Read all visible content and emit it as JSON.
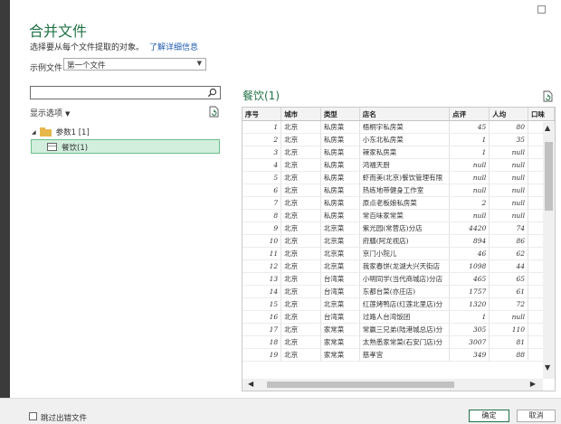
{
  "dialog": {
    "title": "合并文件",
    "subtitle": "选择要从每个文件提取的对象。",
    "learn_more": "了解详细信息",
    "sample_file_label": "示例文件:",
    "sample_file_value": "第一个文件"
  },
  "navigator": {
    "search_placeholder": "",
    "display_options": "显示选项",
    "folder_label": "参数1 [1]",
    "sheet_label": "餐饮(1)"
  },
  "preview": {
    "title": "餐饮(1)",
    "columns": [
      "序号",
      "城市",
      "类型",
      "店名",
      "点评",
      "人均",
      "口味"
    ],
    "rows": [
      [
        "1",
        "北京",
        "私房菜",
        "梧桐宇私房菜",
        "45",
        "80",
        ""
      ],
      [
        "2",
        "北京",
        "私房菜",
        "小东北私房菜",
        "1",
        "35",
        ""
      ],
      [
        "3",
        "北京",
        "私房菜",
        "辣家私房菜",
        "1",
        "null",
        ""
      ],
      [
        "4",
        "北京",
        "私房菜",
        "鸿福天厨",
        "null",
        "null",
        ""
      ],
      [
        "5",
        "北京",
        "私房菜",
        "虾而美(北京)餐饮管理有限",
        "null",
        "null",
        ""
      ],
      [
        "6",
        "北京",
        "私房菜",
        "热练地带健身工作室",
        "null",
        "null",
        ""
      ],
      [
        "7",
        "北京",
        "私房菜",
        "原点老板娘私房菜",
        "2",
        "null",
        ""
      ],
      [
        "8",
        "北京",
        "私房菜",
        "常百味家常菜",
        "null",
        "null",
        ""
      ],
      [
        "9",
        "北京",
        "北京菜",
        "紫光园(常营店)分店",
        "4420",
        "74",
        ""
      ],
      [
        "10",
        "北京",
        "北京菜",
        "府膳(阿龙视店)",
        "894",
        "86",
        ""
      ],
      [
        "11",
        "北京",
        "北京菜",
        "京门小院儿",
        "46",
        "62",
        ""
      ],
      [
        "12",
        "北京",
        "北京菜",
        "我家春饼(龙湖大兴天街店",
        "1098",
        "44",
        ""
      ],
      [
        "13",
        "北京",
        "台湾菜",
        "小明同学(当代商城店)分店",
        "465",
        "65",
        ""
      ],
      [
        "14",
        "北京",
        "台湾菜",
        "东都台菜(亦庄店)",
        "1757",
        "61",
        ""
      ],
      [
        "15",
        "北京",
        "北京菜",
        "红莲烤鸭店(红莲北里店)分",
        "1320",
        "72",
        ""
      ],
      [
        "16",
        "北京",
        "台湾菜",
        "过路人台湾饭团",
        "1",
        "null",
        ""
      ],
      [
        "17",
        "北京",
        "家常菜",
        "常赢三兄弟(陆港城总店)分",
        "305",
        "110",
        ""
      ],
      [
        "18",
        "北京",
        "家常菜",
        "太熟悉家常菜(石安门店)分",
        "3007",
        "81",
        ""
      ],
      [
        "19",
        "北京",
        "家常菜",
        "慈孝宫",
        "349",
        "88",
        ""
      ]
    ]
  },
  "footer": {
    "skip_label": "跳过出错文件",
    "ok": "确定",
    "cancel": "取消"
  },
  "colors": {
    "accent": "#217346",
    "link": "#1f5bb0",
    "selection_bg": "#d2eedd"
  }
}
